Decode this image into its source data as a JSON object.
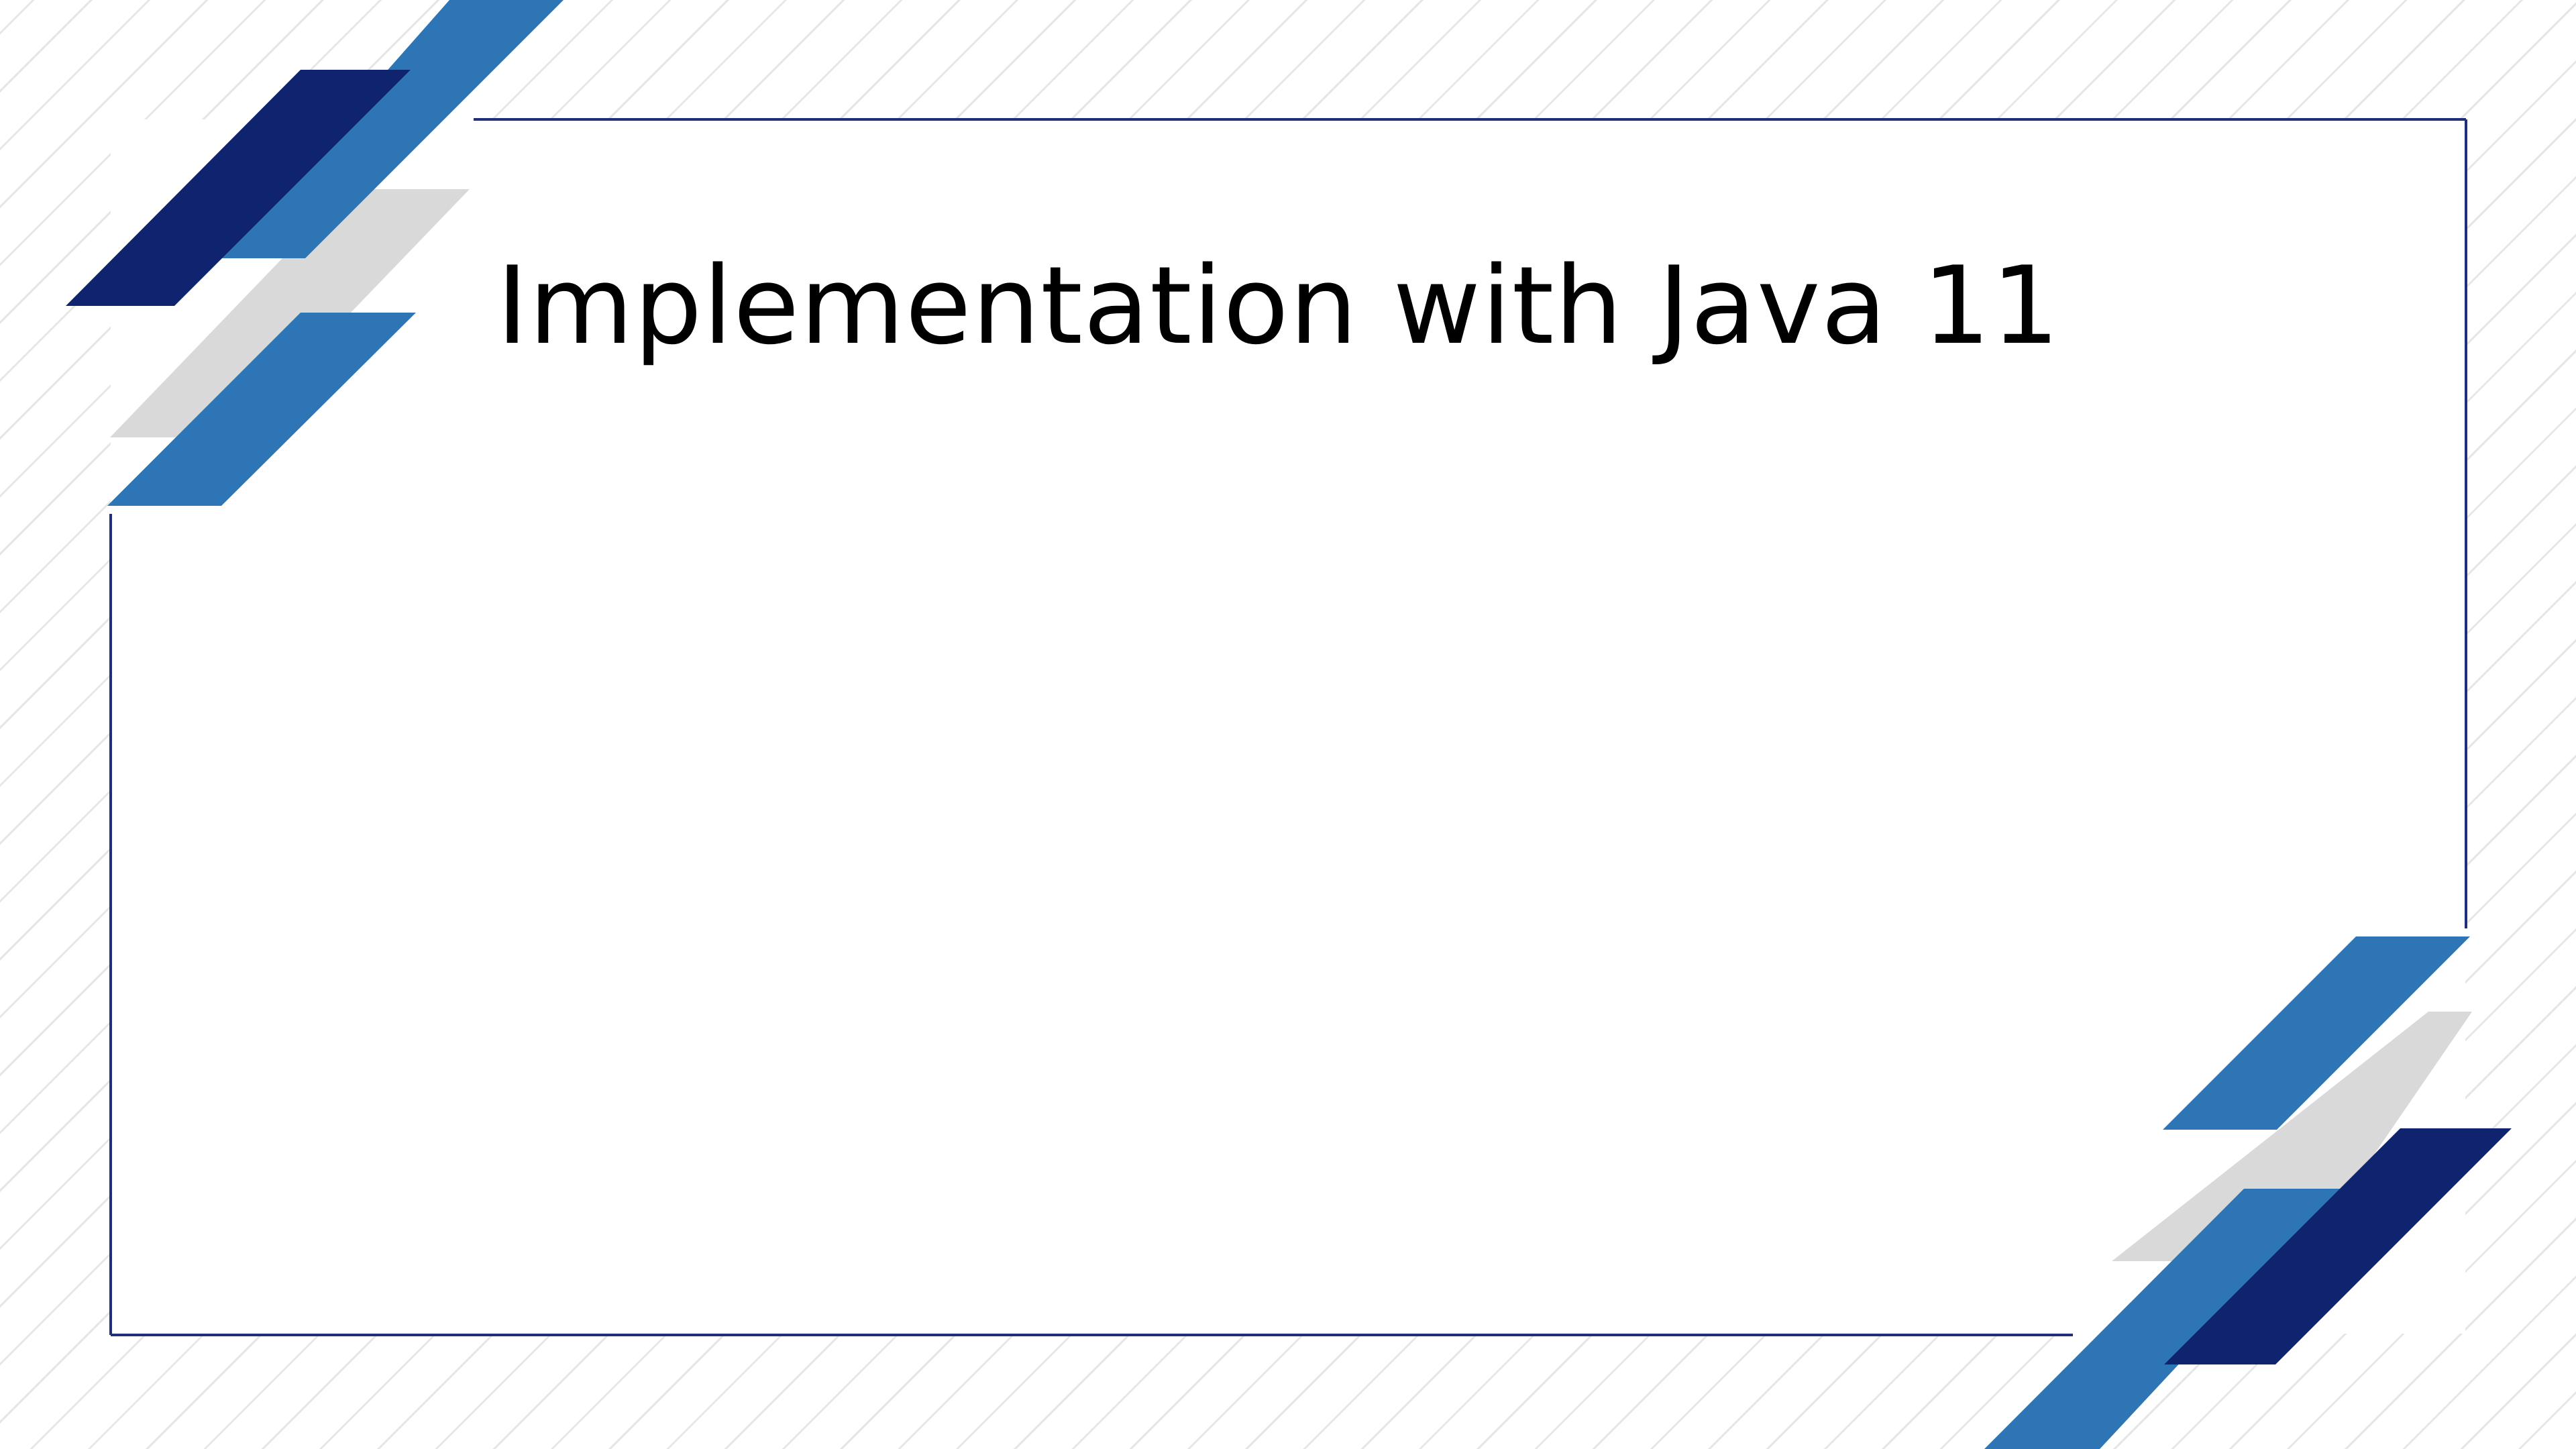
{
  "slide": {
    "title": "Implementation with Java 11"
  },
  "theme": {
    "dark_blue": "#10236e",
    "mid_blue": "#2e75b6",
    "light_gray": "#d9d9d9",
    "frame_line": "#1f2f7a",
    "title_color": "#000000",
    "background_stripes": "#e6e6e6"
  }
}
